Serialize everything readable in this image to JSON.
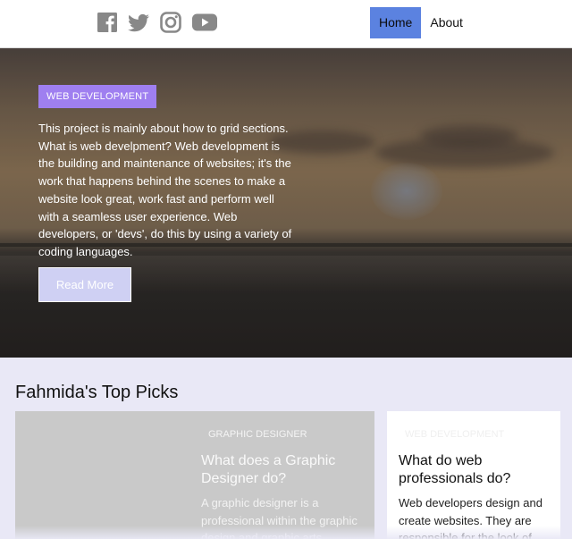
{
  "colors": {
    "accent": "#5b82e0",
    "badge": "#9f7ff0",
    "page_bg": "#e9e8f6",
    "button": "#cfd0f3",
    "icon": "#888888"
  },
  "header": {
    "social": [
      "facebook-icon",
      "twitter-icon",
      "instagram-icon",
      "youtube-icon"
    ],
    "nav": {
      "home": "Home",
      "about": "About"
    }
  },
  "hero": {
    "badge": "WEB DEVELOPMENT",
    "text": "This project is mainly about how to grid sections. What is web develpment? Web development is the building and maintenance of websites; it's the work that happens behind the scenes to make a website look great, work fast and perform well with a seamless user experience. Web developers, or 'devs', do this by using a variety of coding languages.",
    "button": "Read More"
  },
  "picks": {
    "title": "Fahmida's Top Picks",
    "cards": [
      {
        "category": "GRAPHIC DESIGNER",
        "title": "What does a Graphic Designer do?",
        "desc": "A graphic designer is a professional within the graphic design and graphic arts"
      },
      {
        "category": "WEB DEVELOPMENT",
        "title": "What do web professionals do?",
        "desc": "Web developers design and create websites. They are responsible for the look of"
      }
    ]
  }
}
